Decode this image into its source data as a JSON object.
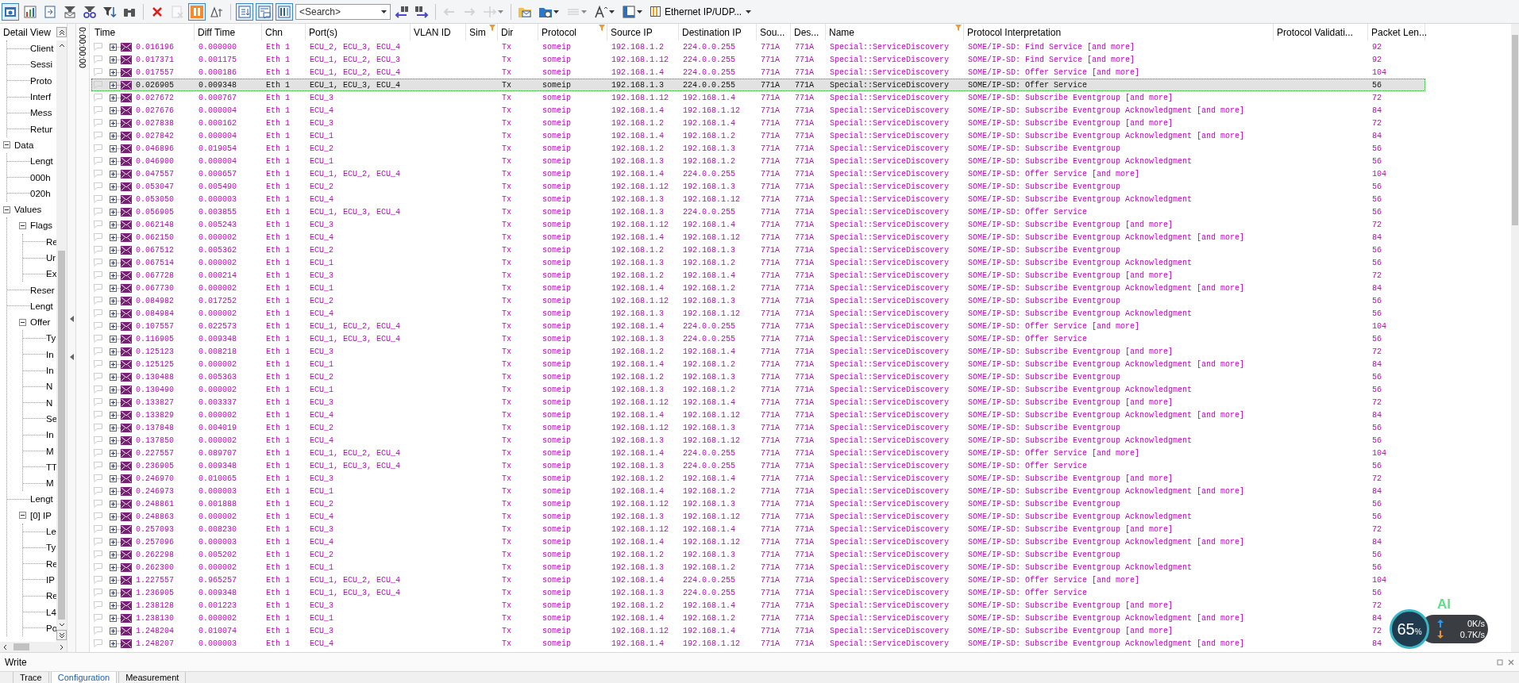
{
  "toolbar": {
    "items": [
      {
        "kind": "trace-view",
        "pressed": true,
        "disabled": false
      },
      {
        "kind": "bar-chart",
        "pressed": false,
        "disabled": false
      },
      {
        "kind": "export",
        "pressed": false,
        "disabled": false
      },
      {
        "kind": "envelope-filter",
        "pressed": false,
        "disabled": false
      },
      {
        "kind": "glasses-filter",
        "pressed": false,
        "disabled": false
      },
      {
        "kind": "funnel-filter",
        "pressed": false,
        "disabled": false
      },
      {
        "kind": "binoculars",
        "pressed": false,
        "disabled": false
      },
      {
        "kind": "separator"
      },
      {
        "kind": "delete",
        "pressed": false,
        "disabled": false
      },
      {
        "kind": "clear",
        "pressed": false,
        "disabled": true
      },
      {
        "kind": "pause",
        "pressed": true,
        "disabled": false
      },
      {
        "kind": "delta",
        "pressed": false,
        "disabled": false
      },
      {
        "kind": "separator"
      },
      {
        "kind": "scroll-down",
        "pressed": true,
        "disabled": false
      },
      {
        "kind": "comment",
        "pressed": true,
        "disabled": false
      },
      {
        "kind": "columns",
        "pressed": true,
        "disabled": false
      },
      {
        "kind": "search",
        "placeholder": "<Search>"
      },
      {
        "kind": "find-prev",
        "pressed": false,
        "disabled": false
      },
      {
        "kind": "find-next",
        "pressed": false,
        "disabled": false
      },
      {
        "kind": "separator"
      },
      {
        "kind": "back",
        "pressed": false,
        "disabled": true
      },
      {
        "kind": "forward",
        "pressed": false,
        "disabled": true
      },
      {
        "kind": "branch",
        "pressed": false,
        "disabled": true
      },
      {
        "kind": "separator"
      },
      {
        "kind": "folder-mail",
        "pressed": false,
        "disabled": false
      },
      {
        "kind": "folder-gear",
        "pressed": false,
        "disabled": false
      },
      {
        "kind": "lines",
        "pressed": false,
        "disabled": true
      },
      {
        "kind": "font-size",
        "pressed": false,
        "disabled": false
      },
      {
        "kind": "layout",
        "pressed": false,
        "disabled": false
      },
      {
        "kind": "dropdown",
        "label": "Ethernet IP/UDP..."
      }
    ]
  },
  "detail_view": {
    "title": "Detail View",
    "continued": [
      {
        "label": "Client"
      },
      {
        "label": "Sessi"
      },
      {
        "label": "Proto"
      },
      {
        "label": "Interf"
      },
      {
        "label": "Mess"
      },
      {
        "label": "Retur"
      }
    ],
    "items": [
      {
        "label": "Data",
        "expanded": true,
        "children": [
          {
            "label": "Lengt"
          },
          {
            "label": "000h"
          },
          {
            "label": "020h"
          }
        ]
      },
      {
        "label": "Values",
        "expanded": true,
        "children": [
          {
            "label": "Flags",
            "expanded": true,
            "children": [
              {
                "label": "Re"
              },
              {
                "label": "Ur"
              },
              {
                "label": "Ex"
              }
            ]
          },
          {
            "label": "Reser"
          },
          {
            "label": "Lengt"
          },
          {
            "label": "Offer",
            "expanded": true,
            "children": [
              {
                "label": "Ty"
              },
              {
                "label": "In"
              },
              {
                "label": "In"
              },
              {
                "label": "N"
              },
              {
                "label": "N"
              },
              {
                "label": "Se"
              },
              {
                "label": "In"
              },
              {
                "label": "M"
              },
              {
                "label": "TT"
              },
              {
                "label": "M"
              }
            ]
          },
          {
            "label": "Lengt"
          },
          {
            "label": "[0] IP",
            "expanded": true,
            "children": [
              {
                "label": "Le"
              },
              {
                "label": "Ty"
              },
              {
                "label": "Re"
              },
              {
                "label": "IP"
              },
              {
                "label": "Re"
              },
              {
                "label": "L4"
              },
              {
                "label": "Po"
              }
            ]
          }
        ]
      }
    ]
  },
  "time_axis": {
    "label": "0:00:00:00"
  },
  "table": {
    "columns": [
      {
        "label": "Time",
        "filter": false
      },
      {
        "label": "Diff Time",
        "filter": false
      },
      {
        "label": "Chn",
        "filter": false
      },
      {
        "label": "Port(s)",
        "filter": false
      },
      {
        "label": "VLAN ID",
        "filter": false
      },
      {
        "label": "Sim",
        "filter": true
      },
      {
        "label": "Dir",
        "filter": false
      },
      {
        "label": "Protocol",
        "filter": true
      },
      {
        "label": "Source IP",
        "filter": false
      },
      {
        "label": "Destination IP",
        "filter": false
      },
      {
        "label": "Sou...",
        "filter": false
      },
      {
        "label": "Des...",
        "filter": false
      },
      {
        "label": "Name",
        "filter": true
      },
      {
        "label": "Protocol Interpretation",
        "filter": false
      },
      {
        "label": "Protocol Validati...",
        "filter": false
      },
      {
        "label": "Packet Len...",
        "filter": false
      }
    ],
    "rows": [
      {
        "time": "0.016196",
        "diff_time": "0.000000",
        "chn": "Eth 1",
        "ports": "ECU_2, ECU_3, ECU_4",
        "dir": "Tx",
        "protocol": "someip",
        "source_ip": "192.168.1.2",
        "destination_ip": "224.0.0.255",
        "column_11": "771A",
        "column_12": "771A",
        "name": "Special::ServiceDiscovery",
        "protocol_interpretation": "SOME/IP-SD: Find Service [and more]",
        "packet_length": "92",
        "selected": false
      },
      {
        "time": "0.017371",
        "diff_time": "0.001175",
        "chn": "Eth 1",
        "ports": "ECU_1, ECU_2, ECU_3",
        "dir": "Tx",
        "protocol": "someip",
        "source_ip": "192.168.1.12",
        "destination_ip": "224.0.0.255",
        "column_11": "771A",
        "column_12": "771A",
        "name": "Special::ServiceDiscovery",
        "protocol_interpretation": "SOME/IP-SD: Find Service [and more]",
        "packet_length": "92",
        "selected": false
      },
      {
        "time": "0.017557",
        "diff_time": "0.000186",
        "chn": "Eth 1",
        "ports": "ECU_1, ECU_2, ECU_4",
        "dir": "Tx",
        "protocol": "someip",
        "source_ip": "192.168.1.4",
        "destination_ip": "224.0.0.255",
        "column_11": "771A",
        "column_12": "771A",
        "name": "Special::ServiceDiscovery",
        "protocol_interpretation": "SOME/IP-SD: Offer Service [and more]",
        "packet_length": "104",
        "selected": false
      },
      {
        "time": "0.026905",
        "diff_time": "0.009348",
        "chn": "Eth 1",
        "ports": "ECU_1, ECU_3, ECU_4",
        "dir": "Tx",
        "protocol": "someip",
        "source_ip": "192.168.1.3",
        "destination_ip": "224.0.0.255",
        "column_11": "771A",
        "column_12": "771A",
        "name": "Special::ServiceDiscovery",
        "protocol_interpretation": "SOME/IP-SD: Offer Service",
        "packet_length": "56",
        "selected": true
      },
      {
        "time": "0.027672",
        "diff_time": "0.000767",
        "chn": "Eth 1",
        "ports": "ECU_3",
        "dir": "Tx",
        "protocol": "someip",
        "source_ip": "192.168.1.12",
        "destination_ip": "192.168.1.4",
        "column_11": "771A",
        "column_12": "771A",
        "name": "Special::ServiceDiscovery",
        "protocol_interpretation": "SOME/IP-SD: Subscribe Eventgroup [and more]",
        "packet_length": "72",
        "selected": false
      },
      {
        "time": "0.027676",
        "diff_time": "0.000004",
        "chn": "Eth 1",
        "ports": "ECU_4",
        "dir": "Tx",
        "protocol": "someip",
        "source_ip": "192.168.1.4",
        "destination_ip": "192.168.1.12",
        "column_11": "771A",
        "column_12": "771A",
        "name": "Special::ServiceDiscovery",
        "protocol_interpretation": "SOME/IP-SD: Subscribe Eventgroup Acknowledgment [and more]",
        "packet_length": "84",
        "selected": false
      },
      {
        "time": "0.027838",
        "diff_time": "0.000162",
        "chn": "Eth 1",
        "ports": "ECU_3",
        "dir": "Tx",
        "protocol": "someip",
        "source_ip": "192.168.1.2",
        "destination_ip": "192.168.1.4",
        "column_11": "771A",
        "column_12": "771A",
        "name": "Special::ServiceDiscovery",
        "protocol_interpretation": "SOME/IP-SD: Subscribe Eventgroup [and more]",
        "packet_length": "72",
        "selected": false
      },
      {
        "time": "0.027842",
        "diff_time": "0.000004",
        "chn": "Eth 1",
        "ports": "ECU_1",
        "dir": "Tx",
        "protocol": "someip",
        "source_ip": "192.168.1.4",
        "destination_ip": "192.168.1.2",
        "column_11": "771A",
        "column_12": "771A",
        "name": "Special::ServiceDiscovery",
        "protocol_interpretation": "SOME/IP-SD: Subscribe Eventgroup Acknowledgment [and more]",
        "packet_length": "84",
        "selected": false
      },
      {
        "time": "0.046896",
        "diff_time": "0.019054",
        "chn": "Eth 1",
        "ports": "ECU_2",
        "dir": "Tx",
        "protocol": "someip",
        "source_ip": "192.168.1.2",
        "destination_ip": "192.168.1.3",
        "column_11": "771A",
        "column_12": "771A",
        "name": "Special::ServiceDiscovery",
        "protocol_interpretation": "SOME/IP-SD: Subscribe Eventgroup",
        "packet_length": "56",
        "selected": false
      },
      {
        "time": "0.046900",
        "diff_time": "0.000004",
        "chn": "Eth 1",
        "ports": "ECU_1",
        "dir": "Tx",
        "protocol": "someip",
        "source_ip": "192.168.1.3",
        "destination_ip": "192.168.1.2",
        "column_11": "771A",
        "column_12": "771A",
        "name": "Special::ServiceDiscovery",
        "protocol_interpretation": "SOME/IP-SD: Subscribe Eventgroup Acknowledgment",
        "packet_length": "56",
        "selected": false
      },
      {
        "time": "0.047557",
        "diff_time": "0.000657",
        "chn": "Eth 1",
        "ports": "ECU_1, ECU_2, ECU_4",
        "dir": "Tx",
        "protocol": "someip",
        "source_ip": "192.168.1.4",
        "destination_ip": "224.0.0.255",
        "column_11": "771A",
        "column_12": "771A",
        "name": "Special::ServiceDiscovery",
        "protocol_interpretation": "SOME/IP-SD: Offer Service [and more]",
        "packet_length": "104",
        "selected": false
      },
      {
        "time": "0.053047",
        "diff_time": "0.005490",
        "chn": "Eth 1",
        "ports": "ECU_2",
        "dir": "Tx",
        "protocol": "someip",
        "source_ip": "192.168.1.12",
        "destination_ip": "192.168.1.3",
        "column_11": "771A",
        "column_12": "771A",
        "name": "Special::ServiceDiscovery",
        "protocol_interpretation": "SOME/IP-SD: Subscribe Eventgroup",
        "packet_length": "56",
        "selected": false
      },
      {
        "time": "0.053050",
        "diff_time": "0.000003",
        "chn": "Eth 1",
        "ports": "ECU_4",
        "dir": "Tx",
        "protocol": "someip",
        "source_ip": "192.168.1.3",
        "destination_ip": "192.168.1.12",
        "column_11": "771A",
        "column_12": "771A",
        "name": "Special::ServiceDiscovery",
        "protocol_interpretation": "SOME/IP-SD: Subscribe Eventgroup Acknowledgment",
        "packet_length": "56",
        "selected": false
      },
      {
        "time": "0.056905",
        "diff_time": "0.003855",
        "chn": "Eth 1",
        "ports": "ECU_1, ECU_3, ECU_4",
        "dir": "Tx",
        "protocol": "someip",
        "source_ip": "192.168.1.3",
        "destination_ip": "224.0.0.255",
        "column_11": "771A",
        "column_12": "771A",
        "name": "Special::ServiceDiscovery",
        "protocol_interpretation": "SOME/IP-SD: Offer Service",
        "packet_length": "56",
        "selected": false
      },
      {
        "time": "0.062148",
        "diff_time": "0.005243",
        "chn": "Eth 1",
        "ports": "ECU_3",
        "dir": "Tx",
        "protocol": "someip",
        "source_ip": "192.168.1.12",
        "destination_ip": "192.168.1.4",
        "column_11": "771A",
        "column_12": "771A",
        "name": "Special::ServiceDiscovery",
        "protocol_interpretation": "SOME/IP-SD: Subscribe Eventgroup [and more]",
        "packet_length": "72",
        "selected": false
      },
      {
        "time": "0.062150",
        "diff_time": "0.000002",
        "chn": "Eth 1",
        "ports": "ECU_4",
        "dir": "Tx",
        "protocol": "someip",
        "source_ip": "192.168.1.4",
        "destination_ip": "192.168.1.12",
        "column_11": "771A",
        "column_12": "771A",
        "name": "Special::ServiceDiscovery",
        "protocol_interpretation": "SOME/IP-SD: Subscribe Eventgroup Acknowledgment [and more]",
        "packet_length": "84",
        "selected": false
      },
      {
        "time": "0.067512",
        "diff_time": "0.005362",
        "chn": "Eth 1",
        "ports": "ECU_2",
        "dir": "Tx",
        "protocol": "someip",
        "source_ip": "192.168.1.2",
        "destination_ip": "192.168.1.3",
        "column_11": "771A",
        "column_12": "771A",
        "name": "Special::ServiceDiscovery",
        "protocol_interpretation": "SOME/IP-SD: Subscribe Eventgroup",
        "packet_length": "56",
        "selected": false
      },
      {
        "time": "0.067514",
        "diff_time": "0.000002",
        "chn": "Eth 1",
        "ports": "ECU_1",
        "dir": "Tx",
        "protocol": "someip",
        "source_ip": "192.168.1.3",
        "destination_ip": "192.168.1.2",
        "column_11": "771A",
        "column_12": "771A",
        "name": "Special::ServiceDiscovery",
        "protocol_interpretation": "SOME/IP-SD: Subscribe Eventgroup Acknowledgment",
        "packet_length": "56",
        "selected": false
      },
      {
        "time": "0.067728",
        "diff_time": "0.000214",
        "chn": "Eth 1",
        "ports": "ECU_3",
        "dir": "Tx",
        "protocol": "someip",
        "source_ip": "192.168.1.2",
        "destination_ip": "192.168.1.4",
        "column_11": "771A",
        "column_12": "771A",
        "name": "Special::ServiceDiscovery",
        "protocol_interpretation": "SOME/IP-SD: Subscribe Eventgroup [and more]",
        "packet_length": "72",
        "selected": false
      },
      {
        "time": "0.067730",
        "diff_time": "0.000002",
        "chn": "Eth 1",
        "ports": "ECU_1",
        "dir": "Tx",
        "protocol": "someip",
        "source_ip": "192.168.1.4",
        "destination_ip": "192.168.1.2",
        "column_11": "771A",
        "column_12": "771A",
        "name": "Special::ServiceDiscovery",
        "protocol_interpretation": "SOME/IP-SD: Subscribe Eventgroup Acknowledgment [and more]",
        "packet_length": "84",
        "selected": false
      },
      {
        "time": "0.084982",
        "diff_time": "0.017252",
        "chn": "Eth 1",
        "ports": "ECU_2",
        "dir": "Tx",
        "protocol": "someip",
        "source_ip": "192.168.1.12",
        "destination_ip": "192.168.1.3",
        "column_11": "771A",
        "column_12": "771A",
        "name": "Special::ServiceDiscovery",
        "protocol_interpretation": "SOME/IP-SD: Subscribe Eventgroup",
        "packet_length": "56",
        "selected": false
      },
      {
        "time": "0.084984",
        "diff_time": "0.000002",
        "chn": "Eth 1",
        "ports": "ECU_4",
        "dir": "Tx",
        "protocol": "someip",
        "source_ip": "192.168.1.3",
        "destination_ip": "192.168.1.12",
        "column_11": "771A",
        "column_12": "771A",
        "name": "Special::ServiceDiscovery",
        "protocol_interpretation": "SOME/IP-SD: Subscribe Eventgroup Acknowledgment",
        "packet_length": "56",
        "selected": false
      },
      {
        "time": "0.107557",
        "diff_time": "0.022573",
        "chn": "Eth 1",
        "ports": "ECU_1, ECU_2, ECU_4",
        "dir": "Tx",
        "protocol": "someip",
        "source_ip": "192.168.1.4",
        "destination_ip": "224.0.0.255",
        "column_11": "771A",
        "column_12": "771A",
        "name": "Special::ServiceDiscovery",
        "protocol_interpretation": "SOME/IP-SD: Offer Service [and more]",
        "packet_length": "104",
        "selected": false
      },
      {
        "time": "0.116905",
        "diff_time": "0.009348",
        "chn": "Eth 1",
        "ports": "ECU_1, ECU_3, ECU_4",
        "dir": "Tx",
        "protocol": "someip",
        "source_ip": "192.168.1.3",
        "destination_ip": "224.0.0.255",
        "column_11": "771A",
        "column_12": "771A",
        "name": "Special::ServiceDiscovery",
        "protocol_interpretation": "SOME/IP-SD: Offer Service",
        "packet_length": "56",
        "selected": false
      },
      {
        "time": "0.125123",
        "diff_time": "0.008218",
        "chn": "Eth 1",
        "ports": "ECU_3",
        "dir": "Tx",
        "protocol": "someip",
        "source_ip": "192.168.1.2",
        "destination_ip": "192.168.1.4",
        "column_11": "771A",
        "column_12": "771A",
        "name": "Special::ServiceDiscovery",
        "protocol_interpretation": "SOME/IP-SD: Subscribe Eventgroup [and more]",
        "packet_length": "72",
        "selected": false
      },
      {
        "time": "0.125125",
        "diff_time": "0.000002",
        "chn": "Eth 1",
        "ports": "ECU_1",
        "dir": "Tx",
        "protocol": "someip",
        "source_ip": "192.168.1.4",
        "destination_ip": "192.168.1.2",
        "column_11": "771A",
        "column_12": "771A",
        "name": "Special::ServiceDiscovery",
        "protocol_interpretation": "SOME/IP-SD: Subscribe Eventgroup Acknowledgment [and more]",
        "packet_length": "84",
        "selected": false
      },
      {
        "time": "0.130488",
        "diff_time": "0.005363",
        "chn": "Eth 1",
        "ports": "ECU_2",
        "dir": "Tx",
        "protocol": "someip",
        "source_ip": "192.168.1.2",
        "destination_ip": "192.168.1.3",
        "column_11": "771A",
        "column_12": "771A",
        "name": "Special::ServiceDiscovery",
        "protocol_interpretation": "SOME/IP-SD: Subscribe Eventgroup",
        "packet_length": "56",
        "selected": false
      },
      {
        "time": "0.130490",
        "diff_time": "0.000002",
        "chn": "Eth 1",
        "ports": "ECU_1",
        "dir": "Tx",
        "protocol": "someip",
        "source_ip": "192.168.1.3",
        "destination_ip": "192.168.1.2",
        "column_11": "771A",
        "column_12": "771A",
        "name": "Special::ServiceDiscovery",
        "protocol_interpretation": "SOME/IP-SD: Subscribe Eventgroup Acknowledgment",
        "packet_length": "56",
        "selected": false
      },
      {
        "time": "0.133827",
        "diff_time": "0.003337",
        "chn": "Eth 1",
        "ports": "ECU_3",
        "dir": "Tx",
        "protocol": "someip",
        "source_ip": "192.168.1.12",
        "destination_ip": "192.168.1.4",
        "column_11": "771A",
        "column_12": "771A",
        "name": "Special::ServiceDiscovery",
        "protocol_interpretation": "SOME/IP-SD: Subscribe Eventgroup [and more]",
        "packet_length": "72",
        "selected": false
      },
      {
        "time": "0.133829",
        "diff_time": "0.000002",
        "chn": "Eth 1",
        "ports": "ECU_4",
        "dir": "Tx",
        "protocol": "someip",
        "source_ip": "192.168.1.4",
        "destination_ip": "192.168.1.12",
        "column_11": "771A",
        "column_12": "771A",
        "name": "Special::ServiceDiscovery",
        "protocol_interpretation": "SOME/IP-SD: Subscribe Eventgroup Acknowledgment [and more]",
        "packet_length": "84",
        "selected": false
      },
      {
        "time": "0.137848",
        "diff_time": "0.004019",
        "chn": "Eth 1",
        "ports": "ECU_2",
        "dir": "Tx",
        "protocol": "someip",
        "source_ip": "192.168.1.12",
        "destination_ip": "192.168.1.3",
        "column_11": "771A",
        "column_12": "771A",
        "name": "Special::ServiceDiscovery",
        "protocol_interpretation": "SOME/IP-SD: Subscribe Eventgroup",
        "packet_length": "56",
        "selected": false
      },
      {
        "time": "0.137850",
        "diff_time": "0.000002",
        "chn": "Eth 1",
        "ports": "ECU_4",
        "dir": "Tx",
        "protocol": "someip",
        "source_ip": "192.168.1.3",
        "destination_ip": "192.168.1.12",
        "column_11": "771A",
        "column_12": "771A",
        "name": "Special::ServiceDiscovery",
        "protocol_interpretation": "SOME/IP-SD: Subscribe Eventgroup Acknowledgment",
        "packet_length": "56",
        "selected": false
      },
      {
        "time": "0.227557",
        "diff_time": "0.089707",
        "chn": "Eth 1",
        "ports": "ECU_1, ECU_2, ECU_4",
        "dir": "Tx",
        "protocol": "someip",
        "source_ip": "192.168.1.4",
        "destination_ip": "224.0.0.255",
        "column_11": "771A",
        "column_12": "771A",
        "name": "Special::ServiceDiscovery",
        "protocol_interpretation": "SOME/IP-SD: Offer Service [and more]",
        "packet_length": "104",
        "selected": false
      },
      {
        "time": "0.236905",
        "diff_time": "0.009348",
        "chn": "Eth 1",
        "ports": "ECU_1, ECU_3, ECU_4",
        "dir": "Tx",
        "protocol": "someip",
        "source_ip": "192.168.1.3",
        "destination_ip": "224.0.0.255",
        "column_11": "771A",
        "column_12": "771A",
        "name": "Special::ServiceDiscovery",
        "protocol_interpretation": "SOME/IP-SD: Offer Service",
        "packet_length": "56",
        "selected": false
      },
      {
        "time": "0.246970",
        "diff_time": "0.010065",
        "chn": "Eth 1",
        "ports": "ECU_3",
        "dir": "Tx",
        "protocol": "someip",
        "source_ip": "192.168.1.2",
        "destination_ip": "192.168.1.4",
        "column_11": "771A",
        "column_12": "771A",
        "name": "Special::ServiceDiscovery",
        "protocol_interpretation": "SOME/IP-SD: Subscribe Eventgroup [and more]",
        "packet_length": "72",
        "selected": false
      },
      {
        "time": "0.246973",
        "diff_time": "0.000003",
        "chn": "Eth 1",
        "ports": "ECU_1",
        "dir": "Tx",
        "protocol": "someip",
        "source_ip": "192.168.1.4",
        "destination_ip": "192.168.1.2",
        "column_11": "771A",
        "column_12": "771A",
        "name": "Special::ServiceDiscovery",
        "protocol_interpretation": "SOME/IP-SD: Subscribe Eventgroup Acknowledgment [and more]",
        "packet_length": "84",
        "selected": false
      },
      {
        "time": "0.248861",
        "diff_time": "0.001888",
        "chn": "Eth 1",
        "ports": "ECU_2",
        "dir": "Tx",
        "protocol": "someip",
        "source_ip": "192.168.1.12",
        "destination_ip": "192.168.1.3",
        "column_11": "771A",
        "column_12": "771A",
        "name": "Special::ServiceDiscovery",
        "protocol_interpretation": "SOME/IP-SD: Subscribe Eventgroup",
        "packet_length": "56",
        "selected": false
      },
      {
        "time": "0.248863",
        "diff_time": "0.000002",
        "chn": "Eth 1",
        "ports": "ECU_4",
        "dir": "Tx",
        "protocol": "someip",
        "source_ip": "192.168.1.3",
        "destination_ip": "192.168.1.12",
        "column_11": "771A",
        "column_12": "771A",
        "name": "Special::ServiceDiscovery",
        "protocol_interpretation": "SOME/IP-SD: Subscribe Eventgroup Acknowledgment",
        "packet_length": "56",
        "selected": false
      },
      {
        "time": "0.257093",
        "diff_time": "0.008230",
        "chn": "Eth 1",
        "ports": "ECU_3",
        "dir": "Tx",
        "protocol": "someip",
        "source_ip": "192.168.1.12",
        "destination_ip": "192.168.1.4",
        "column_11": "771A",
        "column_12": "771A",
        "name": "Special::ServiceDiscovery",
        "protocol_interpretation": "SOME/IP-SD: Subscribe Eventgroup [and more]",
        "packet_length": "72",
        "selected": false
      },
      {
        "time": "0.257096",
        "diff_time": "0.000003",
        "chn": "Eth 1",
        "ports": "ECU_4",
        "dir": "Tx",
        "protocol": "someip",
        "source_ip": "192.168.1.4",
        "destination_ip": "192.168.1.12",
        "column_11": "771A",
        "column_12": "771A",
        "name": "Special::ServiceDiscovery",
        "protocol_interpretation": "SOME/IP-SD: Subscribe Eventgroup Acknowledgment [and more]",
        "packet_length": "84",
        "selected": false
      },
      {
        "time": "0.262298",
        "diff_time": "0.005202",
        "chn": "Eth 1",
        "ports": "ECU_2",
        "dir": "Tx",
        "protocol": "someip",
        "source_ip": "192.168.1.2",
        "destination_ip": "192.168.1.3",
        "column_11": "771A",
        "column_12": "771A",
        "name": "Special::ServiceDiscovery",
        "protocol_interpretation": "SOME/IP-SD: Subscribe Eventgroup",
        "packet_length": "56",
        "selected": false
      },
      {
        "time": "0.262300",
        "diff_time": "0.000002",
        "chn": "Eth 1",
        "ports": "ECU_1",
        "dir": "Tx",
        "protocol": "someip",
        "source_ip": "192.168.1.3",
        "destination_ip": "192.168.1.2",
        "column_11": "771A",
        "column_12": "771A",
        "name": "Special::ServiceDiscovery",
        "protocol_interpretation": "SOME/IP-SD: Subscribe Eventgroup Acknowledgment",
        "packet_length": "56",
        "selected": false
      },
      {
        "time": "1.227557",
        "diff_time": "0.965257",
        "chn": "Eth 1",
        "ports": "ECU_1, ECU_2, ECU_4",
        "dir": "Tx",
        "protocol": "someip",
        "source_ip": "192.168.1.4",
        "destination_ip": "224.0.0.255",
        "column_11": "771A",
        "column_12": "771A",
        "name": "Special::ServiceDiscovery",
        "protocol_interpretation": "SOME/IP-SD: Offer Service [and more]",
        "packet_length": "104",
        "selected": false
      },
      {
        "time": "1.236905",
        "diff_time": "0.009348",
        "chn": "Eth 1",
        "ports": "ECU_1, ECU_3, ECU_4",
        "dir": "Tx",
        "protocol": "someip",
        "source_ip": "192.168.1.3",
        "destination_ip": "224.0.0.255",
        "column_11": "771A",
        "column_12": "771A",
        "name": "Special::ServiceDiscovery",
        "protocol_interpretation": "SOME/IP-SD: Offer Service",
        "packet_length": "56",
        "selected": false
      },
      {
        "time": "1.238128",
        "diff_time": "0.001223",
        "chn": "Eth 1",
        "ports": "ECU_3",
        "dir": "Tx",
        "protocol": "someip",
        "source_ip": "192.168.1.2",
        "destination_ip": "192.168.1.4",
        "column_11": "771A",
        "column_12": "771A",
        "name": "Special::ServiceDiscovery",
        "protocol_interpretation": "SOME/IP-SD: Subscribe Eventgroup [and more]",
        "packet_length": "72",
        "selected": false
      },
      {
        "time": "1.238130",
        "diff_time": "0.000002",
        "chn": "Eth 1",
        "ports": "ECU_1",
        "dir": "Tx",
        "protocol": "someip",
        "source_ip": "192.168.1.4",
        "destination_ip": "192.168.1.2",
        "column_11": "771A",
        "column_12": "771A",
        "name": "Special::ServiceDiscovery",
        "protocol_interpretation": "SOME/IP-SD: Subscribe Eventgroup Acknowledgment [and more]",
        "packet_length": "84",
        "selected": false
      },
      {
        "time": "1.248204",
        "diff_time": "0.010074",
        "chn": "Eth 1",
        "ports": "ECU_3",
        "dir": "Tx",
        "protocol": "someip",
        "source_ip": "192.168.1.12",
        "destination_ip": "192.168.1.4",
        "column_11": "771A",
        "column_12": "771A",
        "name": "Special::ServiceDiscovery",
        "protocol_interpretation": "SOME/IP-SD: Subscribe Eventgroup [and more]",
        "packet_length": "72",
        "selected": false
      },
      {
        "time": "1.248207",
        "diff_time": "0.000003",
        "chn": "Eth 1",
        "ports": "ECU_4",
        "dir": "Tx",
        "protocol": "someip",
        "source_ip": "192.168.1.4",
        "destination_ip": "192.168.1.12",
        "column_11": "771A",
        "column_12": "771A",
        "name": "Special::ServiceDiscovery",
        "protocol_interpretation": "SOME/IP-SD: Subscribe Eventgroup Acknowledgment [and more]",
        "packet_length": "84",
        "selected": false
      }
    ]
  },
  "write_panel": {
    "title": "Write"
  },
  "bottom_tabs": [
    {
      "label": "Trace",
      "selected": false
    },
    {
      "label": "Configuration",
      "selected": true
    },
    {
      "label": "Measurement",
      "selected": false
    }
  ],
  "net_monitor": {
    "badge": "AI",
    "value": "65",
    "unit": "%",
    "upload": "0K/s",
    "download": "0.7K/s"
  }
}
